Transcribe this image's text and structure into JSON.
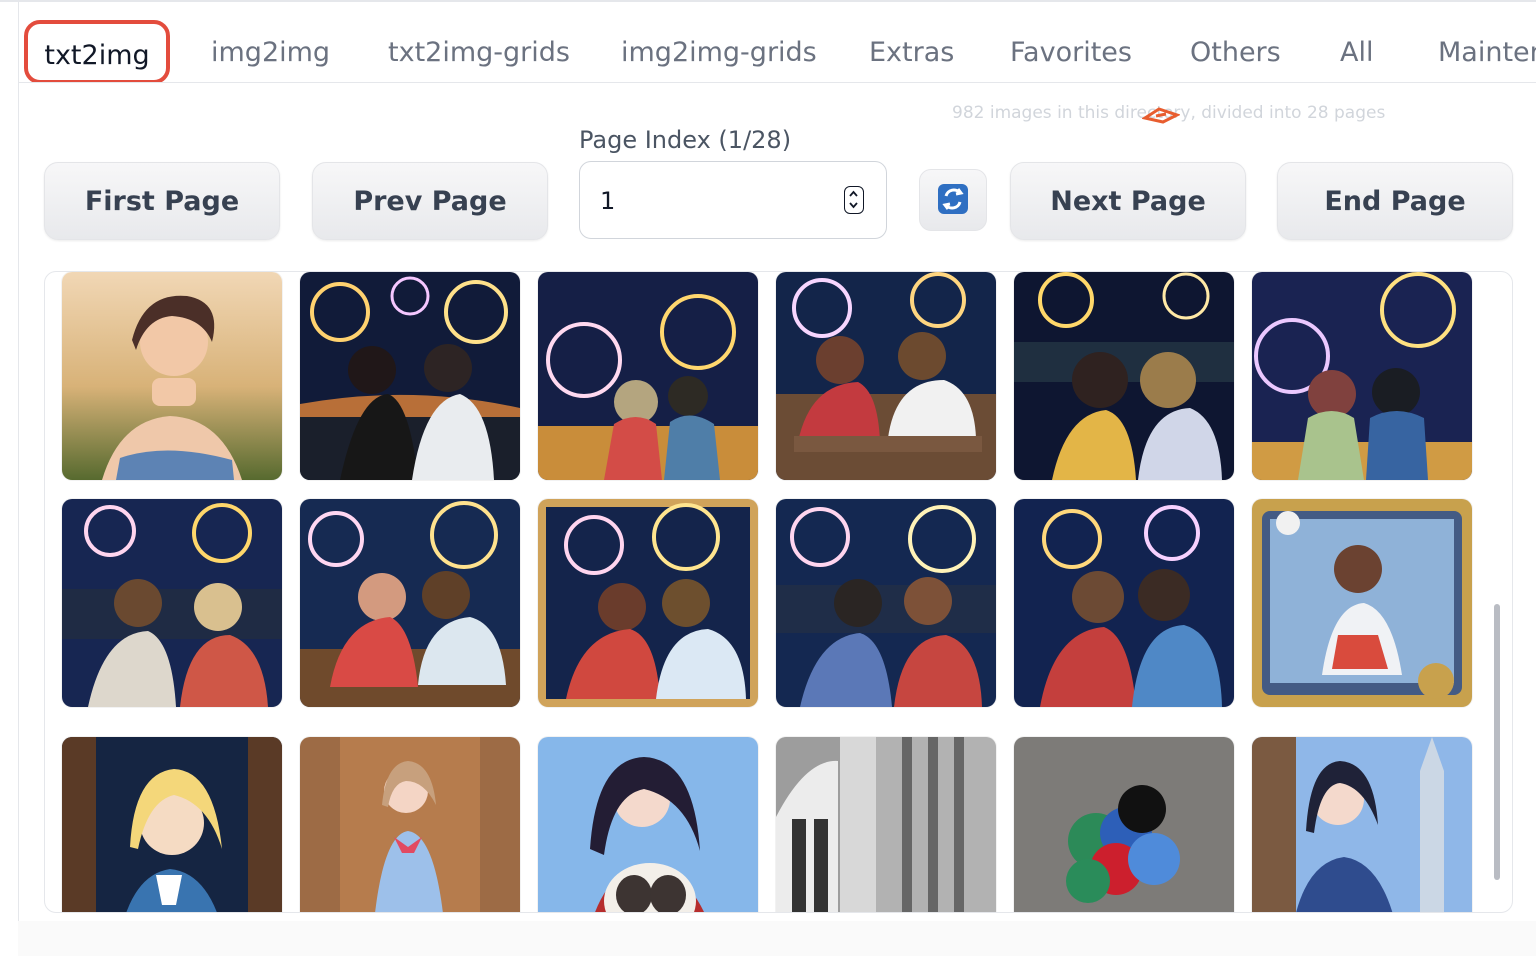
{
  "tabs": [
    {
      "label": "txt2img",
      "active": true
    },
    {
      "label": "img2img"
    },
    {
      "label": "txt2img-grids"
    },
    {
      "label": "img2img-grids"
    },
    {
      "label": "Extras"
    },
    {
      "label": "Favorites"
    },
    {
      "label": "Others"
    },
    {
      "label": "All"
    },
    {
      "label": "Mainten"
    }
  ],
  "meta": {
    "summary": "982 images in this directory, divided into 28 pages"
  },
  "pagination": {
    "label": "Page Index (1/28)",
    "first_label": "First Page",
    "prev_label": "Prev Page",
    "next_label": "Next Page",
    "end_label": "End Page",
    "value": "1"
  },
  "gallery": {
    "items": [
      {
        "name": "thumb-portrait-sunset"
      },
      {
        "name": "thumb-couple-fireworks-night"
      },
      {
        "name": "thumb-couple-back-fireworks"
      },
      {
        "name": "thumb-couple-bench-fireworks"
      },
      {
        "name": "thumb-couple-city-night"
      },
      {
        "name": "thumb-couple-back-seated"
      },
      {
        "name": "thumb-couple-lake-fireworks"
      },
      {
        "name": "thumb-couple-dock-fireworks"
      },
      {
        "name": "thumb-couple-framed-fireworks"
      },
      {
        "name": "thumb-couple-river-fireworks"
      },
      {
        "name": "thumb-couple-hands-fireworks"
      },
      {
        "name": "thumb-anime-card"
      },
      {
        "name": "thumb-blonde-girl-night"
      },
      {
        "name": "thumb-girl-door"
      },
      {
        "name": "thumb-dark-hair-dog"
      },
      {
        "name": "thumb-window-grayscale"
      },
      {
        "name": "thumb-crochet-balls"
      },
      {
        "name": "thumb-girl-church"
      }
    ]
  },
  "colors": {
    "active_tab_border": "#e34c3d",
    "accent": "#2d6fbf"
  }
}
